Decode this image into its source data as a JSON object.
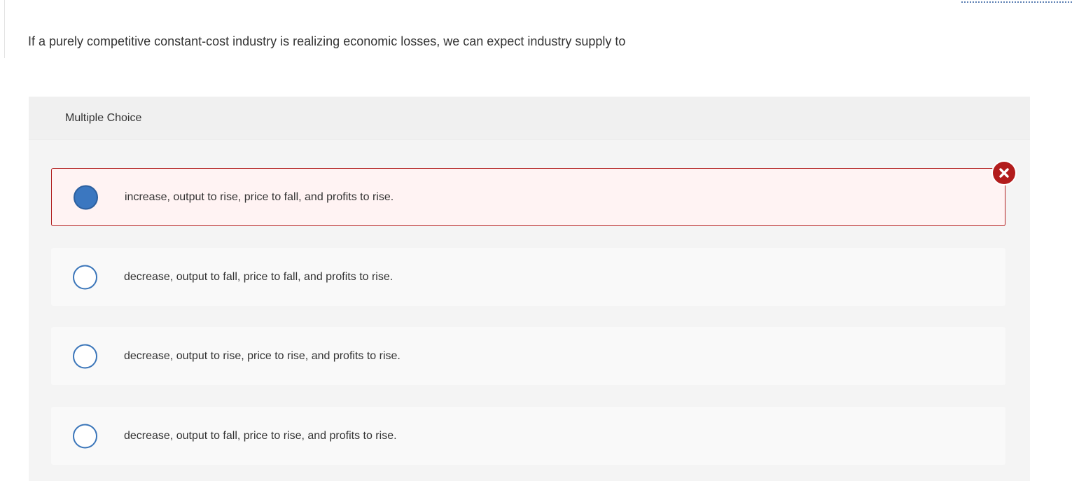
{
  "question": {
    "text": "If a purely competitive constant-cost industry is realizing economic losses, we can expect industry supply to"
  },
  "multiple_choice": {
    "header_label": "Multiple Choice",
    "options": [
      {
        "label": "increase, output to rise, price to fall, and profits to rise.",
        "selected": true,
        "status": "incorrect"
      },
      {
        "label": "decrease, output to fall, price to fall, and profits to rise.",
        "selected": false
      },
      {
        "label": "decrease, output to rise, price to rise, and profits to rise.",
        "selected": false
      },
      {
        "label": "decrease, output to fall, price to rise, and profits to rise.",
        "selected": false
      }
    ],
    "incorrect_icon": "x-circle-icon"
  },
  "colors": {
    "accent_blue": "#3b77c0",
    "error_red": "#b21c1c",
    "panel_bg": "#f4f4f4",
    "error_bg": "#fff3f3"
  }
}
